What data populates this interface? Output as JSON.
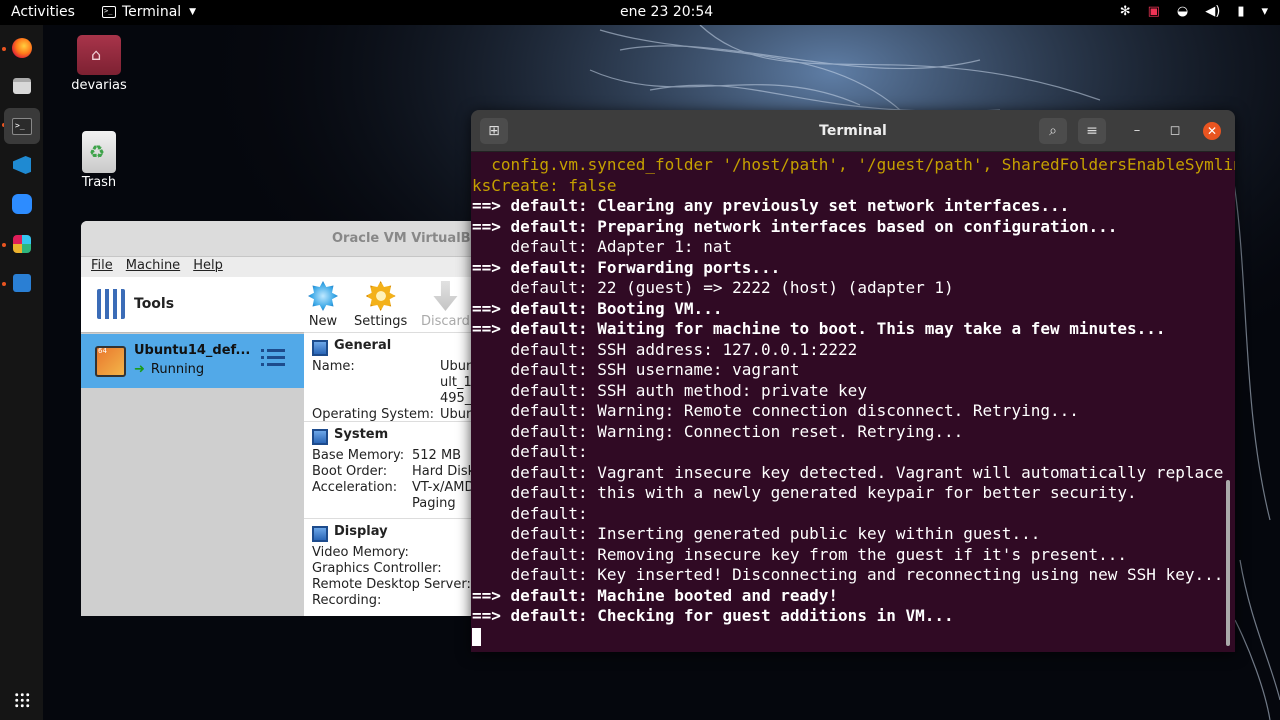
{
  "topbar": {
    "activities": "Activities",
    "app_name": "Terminal",
    "clock": "ene 23  20:54",
    "tray_icons": [
      "extensions-icon",
      "screen-record-icon",
      "network-icon",
      "volume-icon",
      "battery-icon",
      "power-menu-icon"
    ]
  },
  "dock": {
    "apps": [
      "firefox-icon",
      "files-icon",
      "terminal-icon",
      "vscode-icon",
      "zoom-icon",
      "slack-icon",
      "system-monitor-icon"
    ],
    "show_apps": "app-grid-icon"
  },
  "desktop": {
    "home_folder": "devarias",
    "trash": "Trash"
  },
  "virtualbox": {
    "title": "Oracle VM VirtualBox Manager",
    "menu": [
      "File",
      "Machine",
      "Help"
    ],
    "tools_label": "Tools",
    "vm": {
      "name": "Ubuntu14_def...",
      "state": "Running"
    },
    "toolbar": {
      "new": "New",
      "settings": "Settings",
      "discard": "Discard"
    },
    "general": {
      "title": "General",
      "name_label": "Name:",
      "name_value_lines": [
        "Ubun",
        "ult_1",
        "495_"
      ],
      "os_label": "Operating System:",
      "os_value": "Ubun"
    },
    "system": {
      "title": "System",
      "base_memory_label": "Base Memory:",
      "base_memory_value": "512 MB",
      "boot_order_label": "Boot Order:",
      "boot_order_value": "Hard Disk",
      "acceleration_label": "Acceleration:",
      "acceleration_value": "VT-x/AMD",
      "acceleration_value2": "Paging"
    },
    "display": {
      "title": "Display",
      "video_memory_label": "Video Memory:",
      "graphics_label": "Graphics Controller:",
      "rds_label": "Remote Desktop Server:",
      "recording_label": "Recording:"
    }
  },
  "terminal": {
    "title": "Terminal",
    "lines": [
      {
        "text": "  config.vm.synced_folder '/host/path', '/guest/path', SharedFoldersEnableSymlin",
        "style": "warn"
      },
      {
        "text": "ksCreate: false",
        "style": "warn"
      },
      {
        "text": "==> default: Clearing any previously set network interfaces...",
        "style": "bold"
      },
      {
        "text": "==> default: Preparing network interfaces based on configuration...",
        "style": "bold"
      },
      {
        "text": "    default: Adapter 1: nat",
        "style": "normal"
      },
      {
        "text": "==> default: Forwarding ports...",
        "style": "bold"
      },
      {
        "text": "    default: 22 (guest) => 2222 (host) (adapter 1)",
        "style": "normal"
      },
      {
        "text": "==> default: Booting VM...",
        "style": "bold"
      },
      {
        "text": "==> default: Waiting for machine to boot. This may take a few minutes...",
        "style": "bold"
      },
      {
        "text": "    default: SSH address: 127.0.0.1:2222",
        "style": "normal"
      },
      {
        "text": "    default: SSH username: vagrant",
        "style": "normal"
      },
      {
        "text": "    default: SSH auth method: private key",
        "style": "normal"
      },
      {
        "text": "    default: Warning: Remote connection disconnect. Retrying...",
        "style": "normal"
      },
      {
        "text": "    default: Warning: Connection reset. Retrying...",
        "style": "normal"
      },
      {
        "text": "    default:",
        "style": "normal"
      },
      {
        "text": "    default: Vagrant insecure key detected. Vagrant will automatically replace",
        "style": "normal"
      },
      {
        "text": "    default: this with a newly generated keypair for better security.",
        "style": "normal"
      },
      {
        "text": "    default:",
        "style": "normal"
      },
      {
        "text": "    default: Inserting generated public key within guest...",
        "style": "normal"
      },
      {
        "text": "    default: Removing insecure key from the guest if it's present...",
        "style": "normal"
      },
      {
        "text": "    default: Key inserted! Disconnecting and reconnecting using new SSH key...",
        "style": "normal"
      },
      {
        "text": "==> default: Machine booted and ready!",
        "style": "bold"
      },
      {
        "text": "==> default: Checking for guest additions in VM...",
        "style": "bold"
      }
    ]
  },
  "colors": {
    "terminal_bg": "#300a24",
    "terminal_warn": "#c4a000",
    "accent": "#e95420",
    "vm_selected": "#52a9e8"
  }
}
